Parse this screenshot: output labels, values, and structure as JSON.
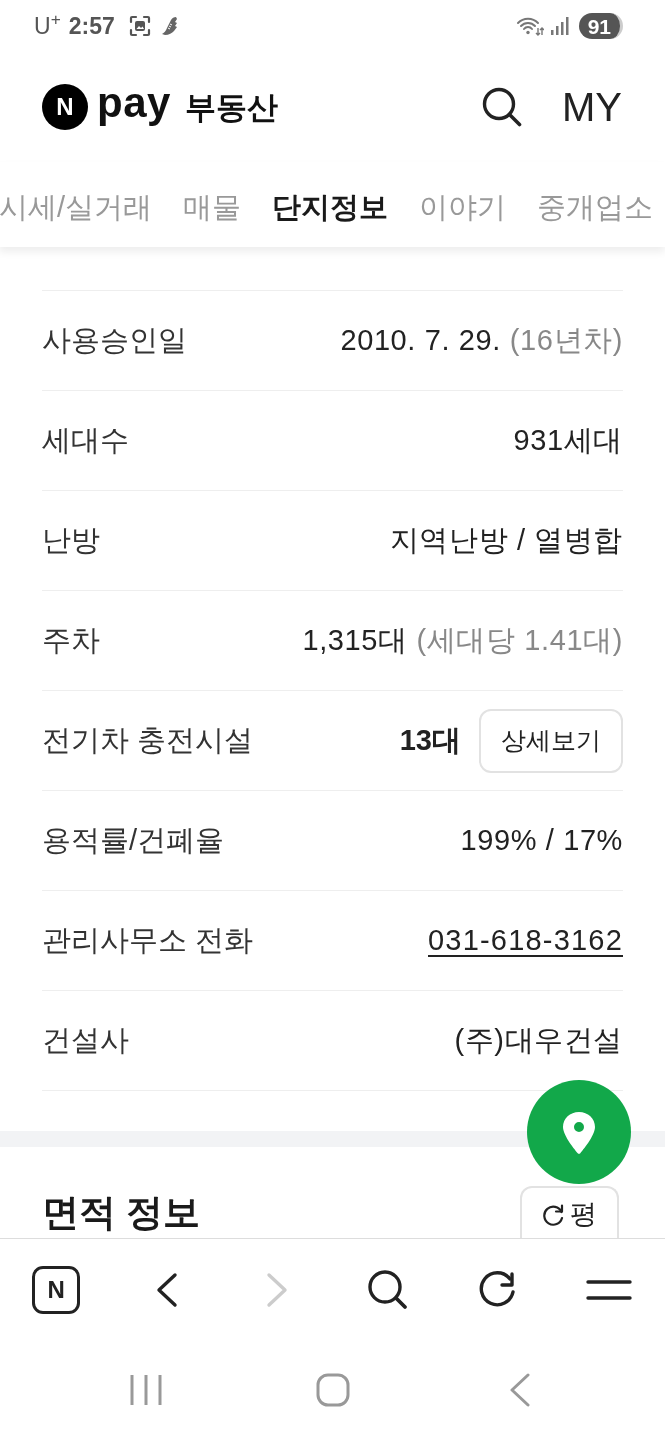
{
  "status_bar": {
    "carrier": "U$^{+}$",
    "time": "2:57",
    "battery": "91"
  },
  "header": {
    "logo_mark": "N",
    "logo_text": "pay",
    "service_name": "부동산",
    "my_link": "MY"
  },
  "tabs": [
    {
      "label": "시세/실거래",
      "selected": false
    },
    {
      "label": "매물",
      "selected": false
    },
    {
      "label": "단지정보",
      "selected": true
    },
    {
      "label": "이야기",
      "selected": false
    },
    {
      "label": "중개업소",
      "selected": false
    }
  ],
  "info_rows": [
    {
      "kind": "note",
      "label": "사용승인일",
      "value": "2010. 7. 29.",
      "note": "(16년차)"
    },
    {
      "kind": "plain",
      "label": "세대수",
      "value": "931세대"
    },
    {
      "kind": "plain",
      "label": "난방",
      "value": "지역난방 / 열병합"
    },
    {
      "kind": "note",
      "label": "주차",
      "value": "1,315대",
      "note": "(세대당 1.41대)"
    },
    {
      "kind": "button",
      "label": "전기차 충전시설",
      "value": "13대",
      "button": "상세보기"
    },
    {
      "kind": "plain",
      "label": "용적률/건폐율",
      "value": "199% / 17%"
    },
    {
      "kind": "link",
      "label": "관리사무소 전화",
      "value": "031-618-3162"
    },
    {
      "kind": "plain",
      "label": "건설사",
      "value": "(주)대우건설"
    }
  ],
  "area_section": {
    "title": "면적 정보",
    "unit_button": "평"
  },
  "browser_toolbar": {
    "home_mark": "N",
    "back_disabled": false,
    "forward_disabled": true
  }
}
